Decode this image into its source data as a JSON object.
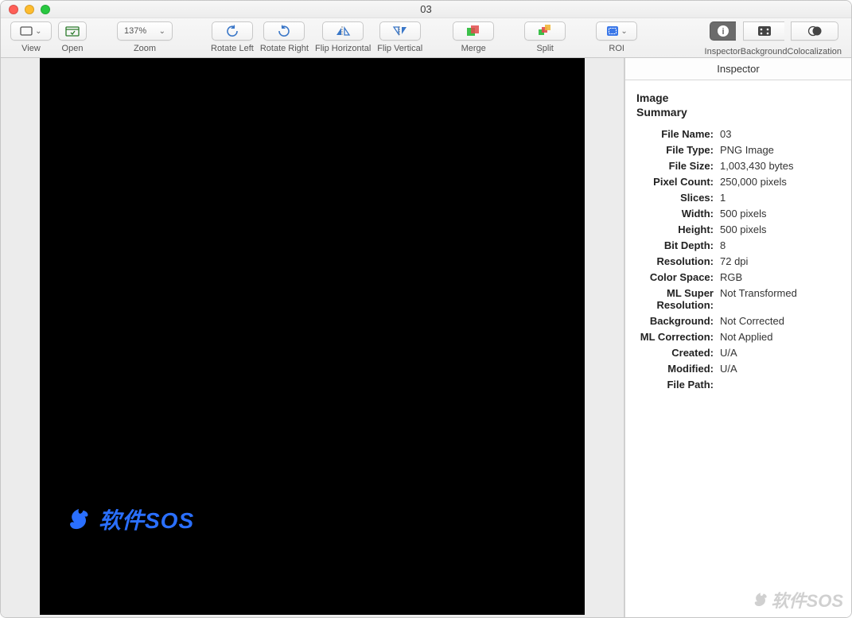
{
  "window": {
    "title": "03"
  },
  "toolbar": {
    "view": "View",
    "open": "Open",
    "zoom": "Zoom",
    "zoom_value": "137%",
    "rotate_left": "Rotate Left",
    "rotate_right": "Rotate Right",
    "flip_h": "Flip Horizontal",
    "flip_v": "Flip Vertical",
    "merge": "Merge",
    "split": "Split",
    "roi": "ROI",
    "inspector": "Inspector",
    "background": "Background",
    "colocalization": "Colocalization"
  },
  "sidebar": {
    "tab": "Inspector",
    "heading1": "Image",
    "heading2": "Summary",
    "labels": {
      "file_name": "File Name:",
      "file_type": "File Type:",
      "file_size": "File Size:",
      "pixel_count": "Pixel Count:",
      "slices": "Slices:",
      "width": "Width:",
      "height": "Height:",
      "bit_depth": "Bit Depth:",
      "resolution": "Resolution:",
      "color_space": "Color Space:",
      "ml_super1": "ML Super",
      "ml_super2": "Resolution:",
      "background": "Background:",
      "ml_correction": "ML Correction:",
      "created": "Created:",
      "modified": "Modified:",
      "file_path": "File Path:"
    },
    "values": {
      "file_name": "03",
      "file_type": "PNG Image",
      "file_size": "1,003,430 bytes",
      "pixel_count": "250,000 pixels",
      "slices": "1",
      "width": "500 pixels",
      "height": "500 pixels",
      "bit_depth": "8",
      "resolution": "72 dpi",
      "color_space": "RGB",
      "ml_super": "Not Transformed",
      "background": "Not Corrected",
      "ml_correction": "Not Applied",
      "created": "U/A",
      "modified": "U/A",
      "file_path": ""
    }
  },
  "canvas": {
    "watermark": "软件SOS"
  },
  "corner_watermark": "软件SOS"
}
